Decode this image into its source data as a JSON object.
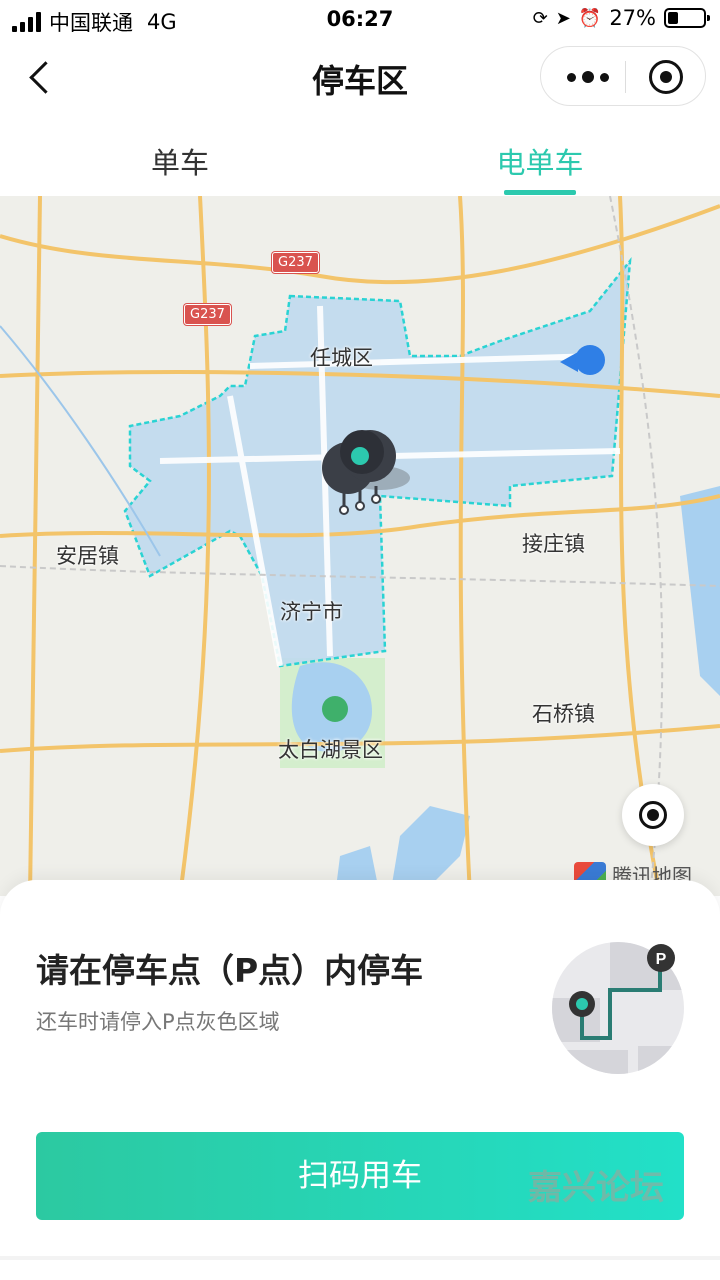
{
  "status_bar": {
    "carrier": "中国联通",
    "network": "4G",
    "time": "06:27",
    "battery": "27%"
  },
  "nav": {
    "title": "停车区"
  },
  "tabs": [
    {
      "label": "单车",
      "active": false
    },
    {
      "label": "电单车",
      "active": true
    }
  ],
  "map": {
    "labels": {
      "rencheng": "任城区",
      "anju": "安居镇",
      "jiezhuang": "接庄镇",
      "jining": "济宁市",
      "shiqiao": "石桥镇",
      "taibai": "太白湖景区"
    },
    "road_signs": [
      "G237",
      "G237"
    ],
    "attribution": "腾讯地图",
    "zone_color": "#bfd9ee",
    "zone_border_color": "#2ad3d3"
  },
  "sheet": {
    "title": "请在停车点（P点）内停车",
    "subtitle": "还车时请停入P点灰色区域",
    "scan_button": "扫码用车",
    "watermark": "嘉兴论坛",
    "accent": "#2cc9ae"
  }
}
